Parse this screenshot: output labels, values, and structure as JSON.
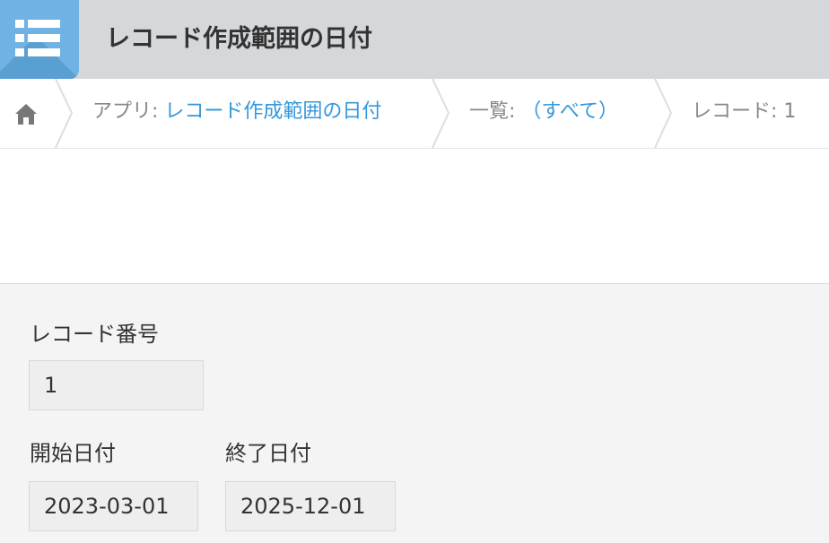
{
  "header": {
    "app_icon": "list-icon",
    "title": "レコード作成範囲の日付",
    "background": "#d5d8da",
    "icon_color": "#6fb2e3"
  },
  "breadcrumb": {
    "home_icon": "home-icon",
    "app_prefix": "アプリ: ",
    "app_name": "レコード作成範囲の日付",
    "view_prefix": "一覧: ",
    "view_name": "（すべて）",
    "record_label": "レコード: 1",
    "link_color": "#3498db"
  },
  "record": {
    "fields": [
      {
        "label": "レコード番号",
        "value": "1"
      },
      {
        "label": "開始日付",
        "value": "2023-03-01"
      },
      {
        "label": "終了日付",
        "value": "2025-12-01"
      }
    ]
  }
}
